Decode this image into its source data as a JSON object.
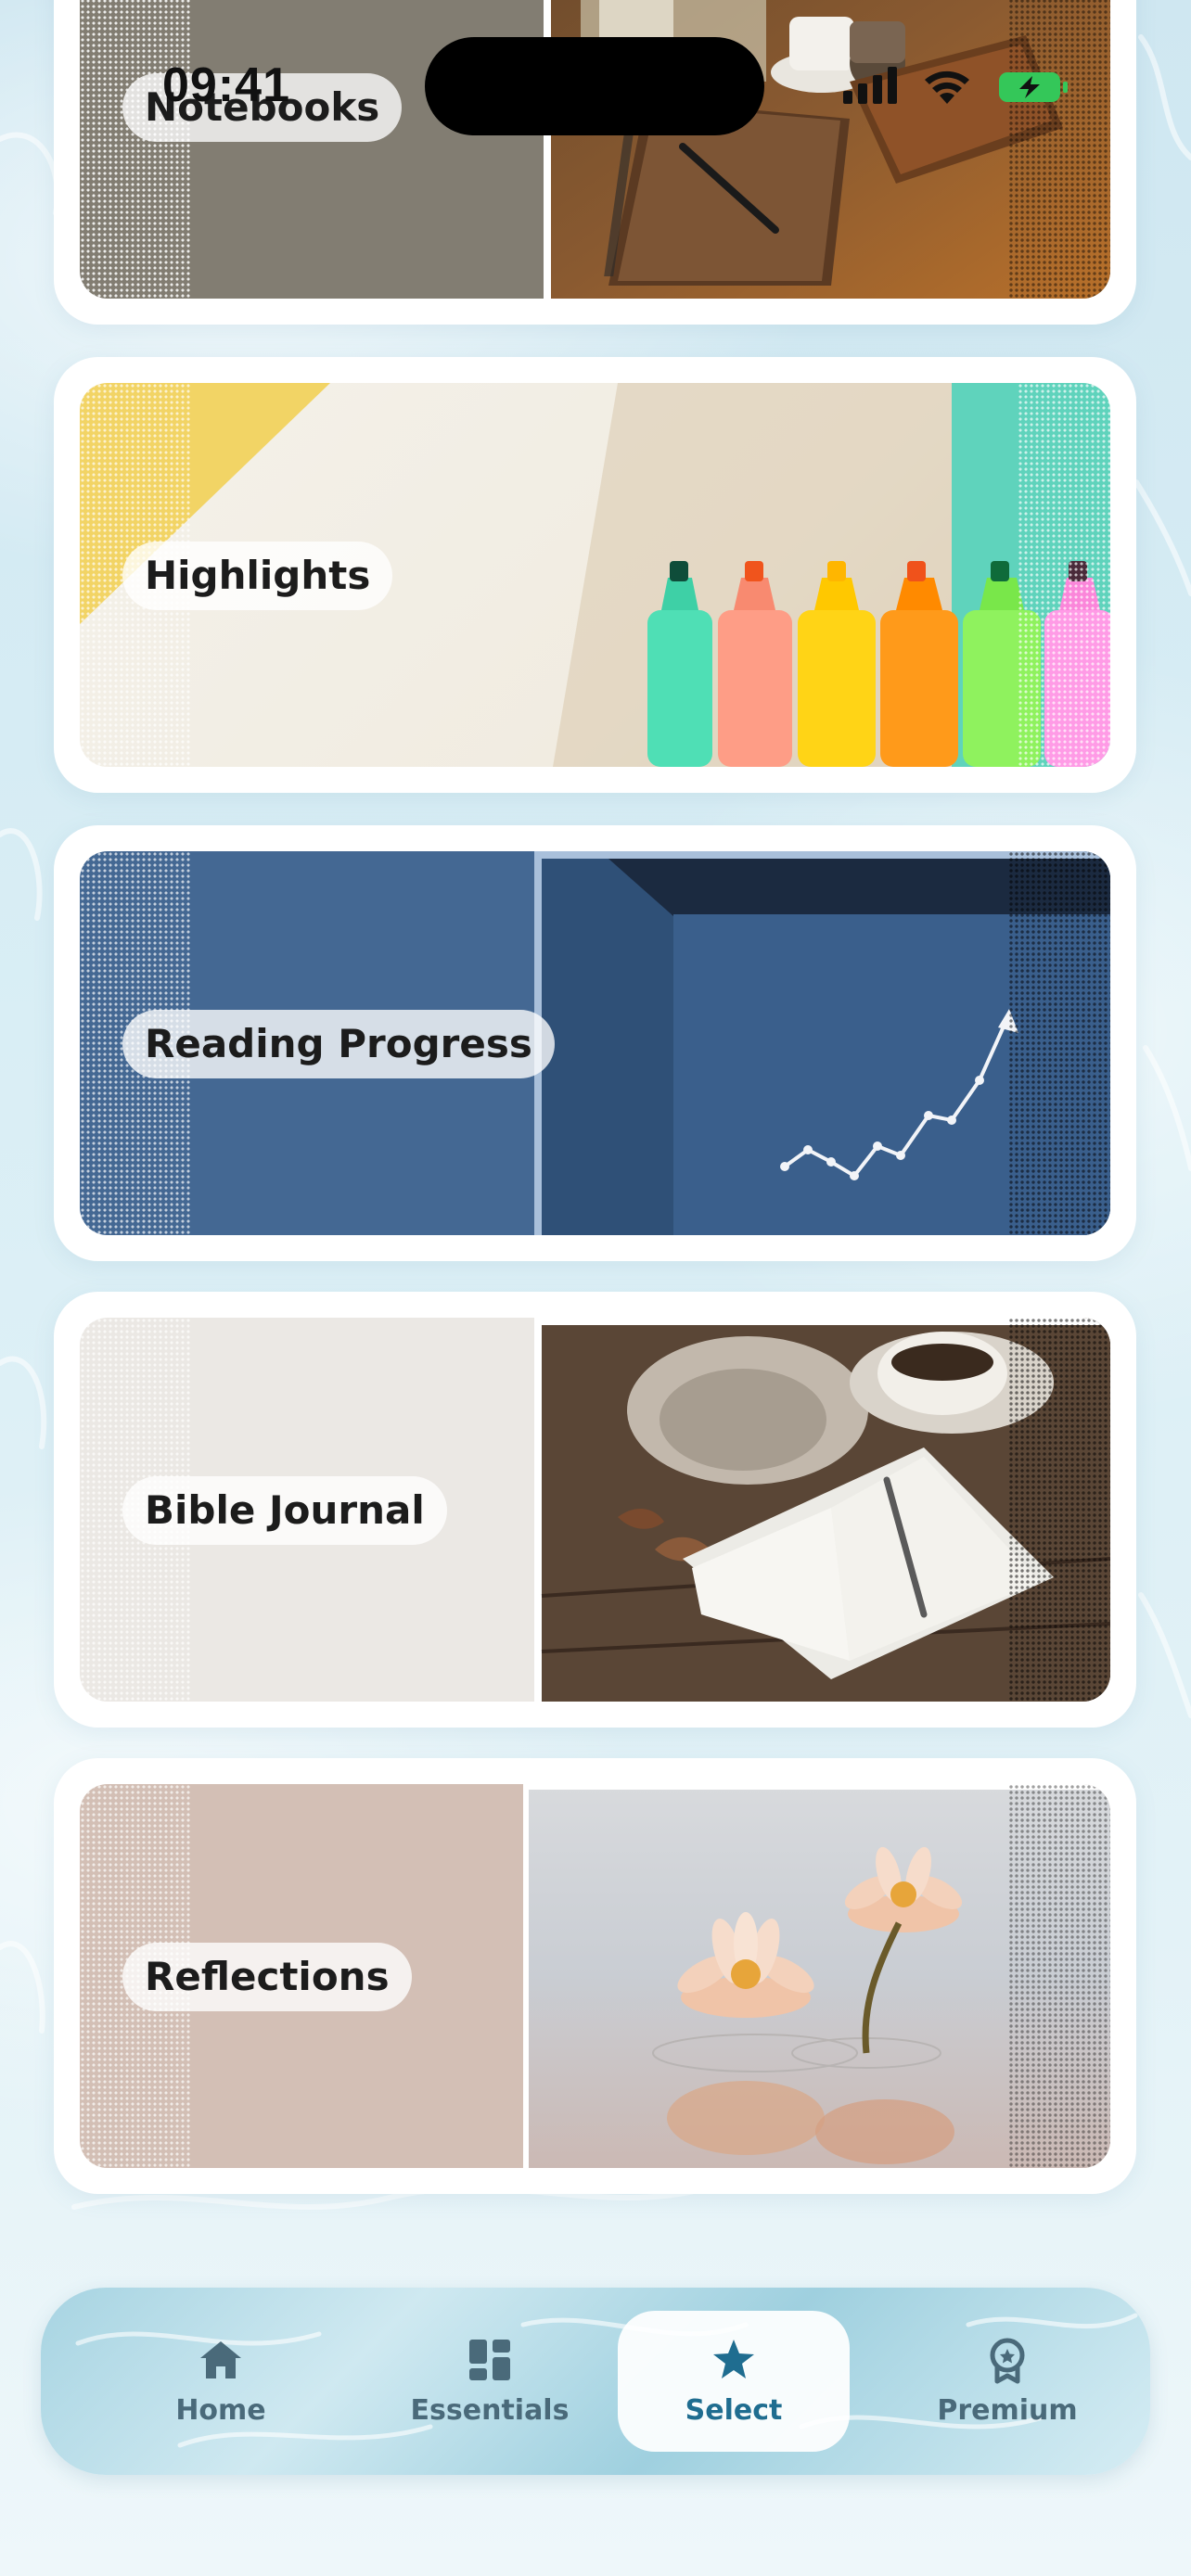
{
  "status_bar": {
    "time": "09:41",
    "icons": [
      "cellular-signal-icon",
      "wifi-icon",
      "battery-charging-icon"
    ],
    "battery_color": "#34c759"
  },
  "cards": [
    {
      "label": "Notebooks",
      "image": "notebooks-photo"
    },
    {
      "label": "Highlights",
      "image": "highlighters-photo"
    },
    {
      "label": "Reading Progress",
      "image": "reading-progress-chart-photo"
    },
    {
      "label": "Bible Journal",
      "image": "journal-coffee-photo"
    },
    {
      "label": "Reflections",
      "image": "water-lilies-photo"
    }
  ],
  "bottom_nav": {
    "items": [
      {
        "label": "Home",
        "icon": "home-icon",
        "active": false
      },
      {
        "label": "Essentials",
        "icon": "dashboard-icon",
        "active": false
      },
      {
        "label": "Select",
        "icon": "star-icon",
        "active": true
      },
      {
        "label": "Premium",
        "icon": "award-badge-icon",
        "active": false
      }
    ],
    "active_color": "#1f6d90",
    "inactive_color": "#4a6a7a"
  }
}
